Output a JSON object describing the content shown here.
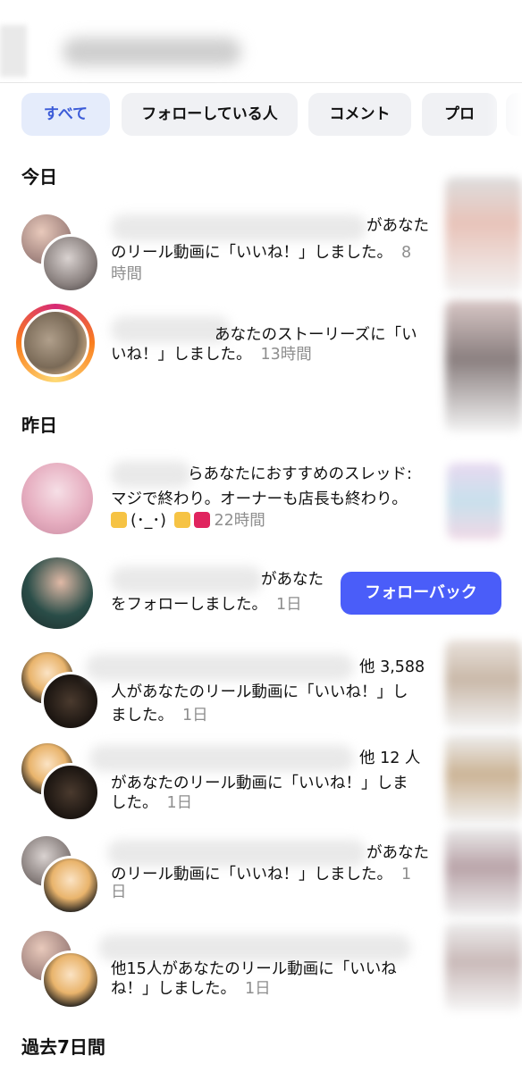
{
  "tabs": [
    "すべて",
    "フォローしている人",
    "コメント",
    "プロ"
  ],
  "sections": {
    "today": "今日",
    "yesterday": "昨日",
    "last7": "過去7日間"
  },
  "notifications": [
    {
      "line1": "があなた",
      "line2": "のリール動画に「いいね！」しました。",
      "time": "8",
      "time2": "時間"
    },
    {
      "line1": "あなたのストーリーズに「い",
      "line2": "いね！」しました。",
      "time": "13時間"
    },
    {
      "line1": "らあなたにおすすめのスレッド:",
      "line2": "マジで終わり。オーナーも店長も終わり。",
      "line3": "(･_･)",
      "time": "22時間"
    },
    {
      "line1": "があなた",
      "line2": "をフォローしました。",
      "time": "1日",
      "button": "フォローバック"
    },
    {
      "line1": "他 3,588",
      "line2": "人があなたのリール動画に「いいね！」し",
      "line3": "ました。",
      "time": "1日"
    },
    {
      "line1": "他 12 人",
      "line2": "があなたのリール動画に「いいね！」しま",
      "line3": "した。",
      "time": "1日"
    },
    {
      "line1": "があなた",
      "line2": "のリール動画に「いいね！」しました。",
      "time": "1",
      "time2": "日"
    },
    {
      "line1": "他15人があなたのリール動画に「いいね",
      "line2": "ね！」しました。",
      "time": "1日"
    }
  ],
  "colors": {
    "accent": "#4a5df9",
    "active_tab_bg": "#e5ecfb",
    "muted": "#8e8e8e"
  }
}
